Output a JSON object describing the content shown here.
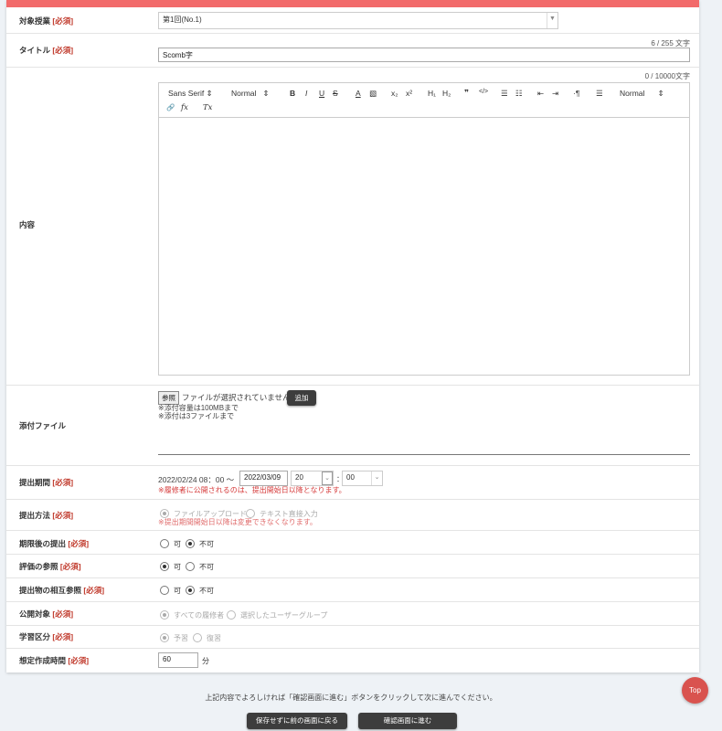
{
  "form": {
    "required_tag": "[必須]",
    "course": {
      "label": "対象授業",
      "value": "第1回(No.1)"
    },
    "title": {
      "label": "タイトル",
      "counter": "6 / 255 文字",
      "value": "Scomb字"
    },
    "content": {
      "label": "内容",
      "counter": "0  / 10000文字",
      "toolbar": {
        "font": "Sans Serif",
        "size": "Normal",
        "bold": "B",
        "italic": "I",
        "underline": "U",
        "strike": "S",
        "color": "A",
        "highlight": "▧",
        "subscript": "x₂",
        "superscript": "x²",
        "h1": "H₁",
        "h2": "H₂",
        "quote": "❞",
        "code": "</>",
        "ol": "☰",
        "ul": "☷",
        "outdent": "⇤",
        "indent": "⇥",
        "rtl": "·¶",
        "align": "☰",
        "align_value": "Normal",
        "link": "🔗",
        "formula": "fx",
        "clear": "Tx"
      }
    },
    "attachment": {
      "label": "添付ファイル",
      "browse": "参照",
      "no_file": "ファイルが選択されていません。",
      "add": "追加",
      "note1": "※添付容量は100MBまで",
      "note2": "※添付は3ファイルまで"
    },
    "period": {
      "label": "提出期間",
      "start": "2022/02/24 08：00 ～",
      "date": "2022/03/09",
      "hour": "20",
      "colon": "：",
      "minute": "00",
      "warning": "※履修者に公開されるのは、提出開始日以降となります。"
    },
    "method": {
      "label": "提出方法",
      "opt1": "ファイルアップロード",
      "opt2": "テキスト直接入力",
      "warning": "※提出期間開始日以降は変更できなくなります。"
    },
    "late": {
      "label": "期限後の提出",
      "opt1": "可",
      "opt2": "不可"
    },
    "eval": {
      "label": "評価の参照",
      "opt1": "可",
      "opt2": "不可"
    },
    "mutual": {
      "label": "提出物の相互参照",
      "opt1": "可",
      "opt2": "不可"
    },
    "audience": {
      "label": "公開対象",
      "opt1": "すべての履修者",
      "opt2": "選択したユーザーグループ"
    },
    "study": {
      "label": "学習区分",
      "opt1": "予習",
      "opt2": "復習"
    },
    "time": {
      "label": "想定作成時間",
      "value": "60",
      "unit": "分"
    }
  },
  "footer": {
    "message": "上記内容でよろしければ「確認画面に進む」ボタンをクリックして次に進んでください。",
    "back": "保存せずに前の画面に戻る",
    "confirm": "確認画面に進む",
    "top": "Top"
  },
  "colors": {
    "accent": "#f26a6a",
    "warning": "#d63b3b",
    "top_button": "#d9534f"
  }
}
